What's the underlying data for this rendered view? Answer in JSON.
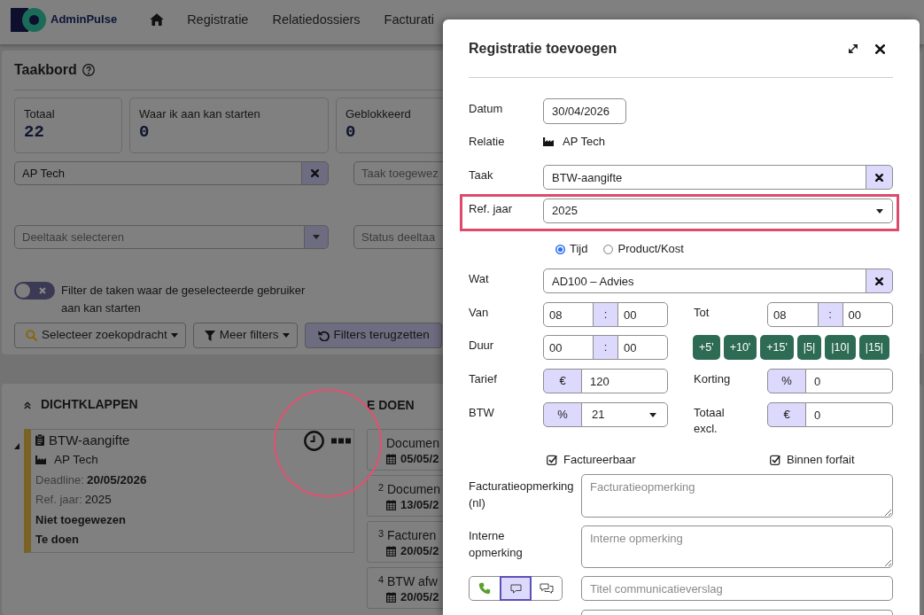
{
  "navbar": {
    "brand": "AdminPulse",
    "items": [
      {
        "label": "Registratie",
        "selected": false
      },
      {
        "label": "Relatiedossiers",
        "selected": false
      },
      {
        "label": "Facturati",
        "selected": false
      }
    ]
  },
  "taskboard": {
    "title": "Taakbord",
    "stats": [
      {
        "label": "Totaal",
        "value": "22"
      },
      {
        "label": "Waar ik aan kan starten",
        "value": "0"
      },
      {
        "label": "Geblokkeerd",
        "value": "0"
      }
    ],
    "filters": [
      {
        "kind": "clearable",
        "value": "AP Tech"
      },
      {
        "kind": "plain",
        "placeholder": "Taak toegewez"
      },
      {
        "kind": "dropdown",
        "placeholder": "Deeltaak selecteren"
      },
      {
        "kind": "plain",
        "placeholder": "Status deeltaa"
      }
    ],
    "toggle": {
      "label": "Filter de taken waar de geselecteerde gebruiker aan kan starten",
      "on": false
    },
    "buttons": [
      {
        "kind": "search",
        "label": "Selecteer zoekopdracht",
        "dropdown": true
      },
      {
        "kind": "filter",
        "label": "Meer filters",
        "dropdown": true
      },
      {
        "kind": "reset",
        "label": "Filters terugzetten",
        "dropdown": false
      }
    ]
  },
  "board": {
    "collapse_label": "DICHTKLAPPEN",
    "task": {
      "title": "BTW-aangifte",
      "relation": "AP Tech",
      "deadline_label": "Deadline:",
      "deadline": "20/05/2026",
      "ref_year_label": "Ref. jaar:",
      "ref_year": "2025",
      "assignee": "Niet toegewezen",
      "status": "Te doen",
      "highlighted": true
    },
    "column": {
      "title": "E DOEN",
      "cards": [
        {
          "title": "Documen",
          "date": "05/05/2"
        },
        {
          "number": "2",
          "title": "Documen",
          "date": "13/05/2"
        },
        {
          "number": "3",
          "title": "Facturen",
          "date": "20/05/2"
        },
        {
          "number": "4",
          "title": "BTW afw",
          "date": "20/05/2"
        }
      ]
    }
  },
  "modal": {
    "title": "Registratie toevoegen",
    "date": {
      "label": "Datum",
      "value": "30/04/2026"
    },
    "relation": {
      "label": "Relatie",
      "value": "AP Tech"
    },
    "task": {
      "label": "Taak",
      "value": "BTW-aangifte"
    },
    "ref_year": {
      "label": "Ref. jaar",
      "value": "2025",
      "highlighted": true
    },
    "types": [
      {
        "label": "Tijd",
        "selected": true
      },
      {
        "label": "Product/Kost",
        "selected": false
      }
    ],
    "what": {
      "label": "Wat",
      "value": "AD100 – Advies"
    },
    "times": [
      {
        "label": "Van",
        "hours": "08",
        "separator": ":",
        "minutes": "00"
      },
      {
        "label": "Tot",
        "hours": "08",
        "separator": ":",
        "minutes": "00"
      },
      {
        "label": "Duur",
        "hours": "00",
        "separator": ":",
        "minutes": "00"
      }
    ],
    "quick_buttons": [
      "+5'",
      "+10'",
      "+15'",
      "|5|",
      "|10|",
      "|15|"
    ],
    "amounts": [
      {
        "label": "Tarief",
        "unit": "€",
        "value": "120",
        "kind": "input"
      },
      {
        "label": "Korting",
        "unit": "%",
        "value": "0",
        "kind": "input"
      },
      {
        "label": "BTW",
        "unit": "%",
        "value": "21",
        "kind": "select"
      },
      {
        "label": "Totaal excl.",
        "unit": "€",
        "value": "0",
        "kind": "input"
      }
    ],
    "checks": [
      {
        "label": "Factureerbaar",
        "checked": true
      },
      {
        "label": "Binnen forfait",
        "checked": true
      }
    ],
    "invoice_note": {
      "label": "Facturatieopmerking (nl)",
      "placeholder": "Facturatieopmerking"
    },
    "internal_note": {
      "label": "Interne opmerking",
      "placeholder": "Interne opmerking"
    },
    "channels": [
      {
        "kind": "phone",
        "selected": false
      },
      {
        "kind": "message",
        "selected": true
      },
      {
        "kind": "conversation",
        "selected": false
      }
    ],
    "report_title": {
      "placeholder": "Titel communicatieverslag"
    }
  }
}
